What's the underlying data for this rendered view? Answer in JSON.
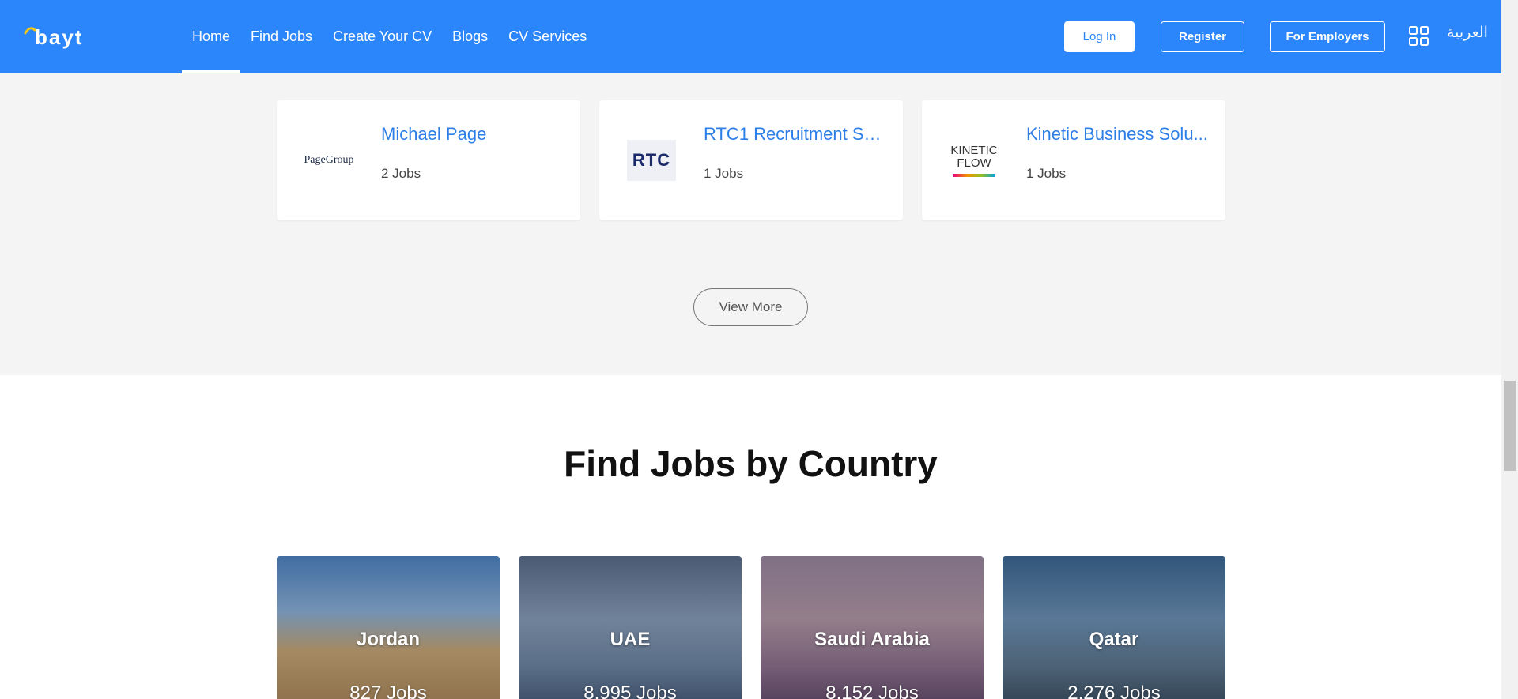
{
  "header": {
    "logo_text": "bayt",
    "nav": [
      {
        "label": "Home",
        "active": true
      },
      {
        "label": "Find Jobs",
        "active": false
      },
      {
        "label": "Create Your CV",
        "active": false
      },
      {
        "label": "Blogs",
        "active": false
      },
      {
        "label": "CV Services",
        "active": false
      }
    ],
    "login_label": "Log In",
    "register_label": "Register",
    "employers_label": "For Employers",
    "apps_icon": "grid-icon",
    "language_label": "العربية"
  },
  "companies": [
    {
      "name": "Michael Page",
      "jobs": "2 Jobs",
      "logo_text": "PageGroup"
    },
    {
      "name": "RTC1 Recruitment Se...",
      "jobs": "1 Jobs",
      "logo_text": "RTC"
    },
    {
      "name": "Kinetic Business Solu...",
      "jobs": "1 Jobs",
      "logo_text": "KINETIC FLOW"
    }
  ],
  "view_more_label": "View More",
  "countries_section": {
    "title": "Find Jobs by Country",
    "items": [
      {
        "name": "Jordan",
        "jobs": "827 Jobs"
      },
      {
        "name": "UAE",
        "jobs": "8,995 Jobs"
      },
      {
        "name": "Saudi Arabia",
        "jobs": "8,152 Jobs"
      },
      {
        "name": "Qatar",
        "jobs": "2,276 Jobs"
      }
    ]
  },
  "colors": {
    "brand": "#2b85fb",
    "link": "#2b7ee8",
    "section_bg": "#f4f4f4"
  }
}
